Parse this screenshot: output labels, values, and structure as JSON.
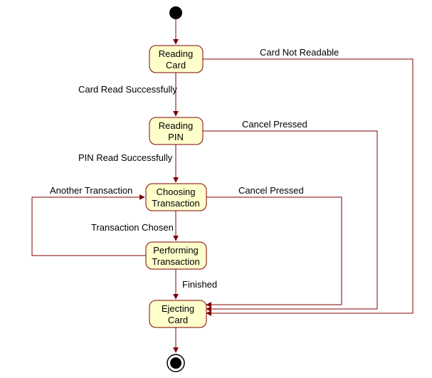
{
  "diagram": {
    "type": "uml-state-diagram",
    "states": {
      "reading_card": {
        "l1": "Reading",
        "l2": "Card"
      },
      "reading_pin": {
        "l1": "Reading",
        "l2": "PIN"
      },
      "choosing_tx": {
        "l1": "Choosing",
        "l2": "Transaction"
      },
      "performing_tx": {
        "l1": "Performing",
        "l2": "Transaction"
      },
      "ejecting_card": {
        "l1": "Ejecting",
        "l2": "Card"
      }
    },
    "transitions": {
      "card_not_readable": "Card Not Readable",
      "card_read_success": "Card Read Successfully",
      "cancel_from_pin": "Cancel Pressed",
      "pin_read_success": "PIN Read Successfully",
      "cancel_from_choose": "Cancel Pressed",
      "another_tx": "Another Transaction",
      "tx_chosen": "Transaction Chosen",
      "finished": "Finished"
    }
  }
}
